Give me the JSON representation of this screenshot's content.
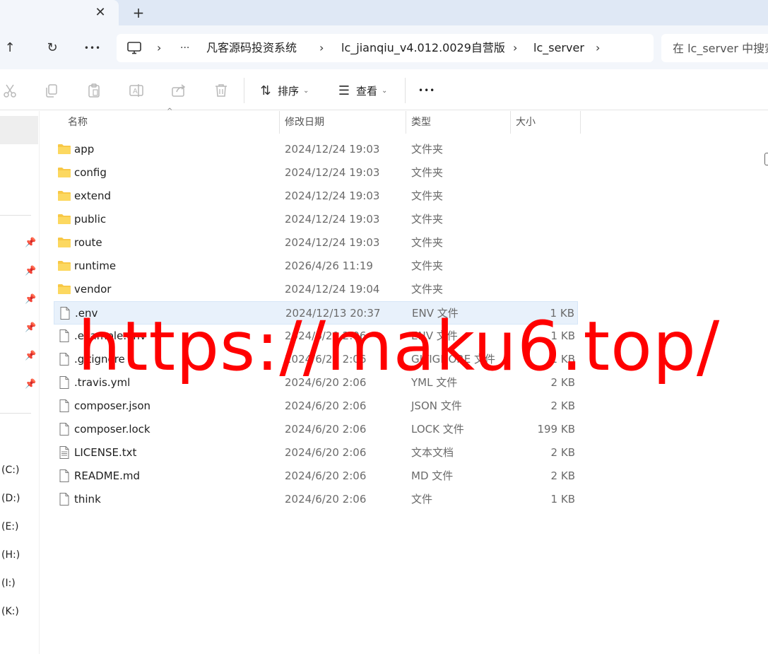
{
  "tabs": {
    "close_glyph": "✕",
    "new_glyph": "+"
  },
  "nav": {
    "up_glyph": "↑",
    "refresh_glyph": "↻",
    "more_glyph": "•••"
  },
  "breadcrumb": {
    "more_glyph": "···",
    "items": [
      {
        "label": "凡客源码投资系统"
      },
      {
        "label": "lc_jianqiu_v4.012.0029自营版"
      },
      {
        "label": "lc_server"
      }
    ],
    "chevron": "›"
  },
  "search": {
    "placeholder": "在 lc_server 中搜索"
  },
  "toolbar": {
    "sort_label": "排序",
    "view_label": "查看",
    "more_label": "•••",
    "dropdown_glyph": "⌄"
  },
  "leftnav": {
    "drives": [
      {
        "label": "(C:)"
      },
      {
        "label": "(D:)"
      },
      {
        "label": "(E:)"
      },
      {
        "label": "(H:)"
      },
      {
        "label": "(I:)"
      },
      {
        "label": "(K:)"
      }
    ]
  },
  "columns": {
    "name": "名称",
    "date": "修改日期",
    "type": "类型",
    "size": "大小",
    "sort_glyph": "^"
  },
  "files": [
    {
      "name": "app",
      "date": "2024/12/24 19:03",
      "type": "文件夹",
      "size": "",
      "icon": "folder-icon"
    },
    {
      "name": "config",
      "date": "2024/12/24 19:03",
      "type": "文件夹",
      "size": "",
      "icon": "folder-icon"
    },
    {
      "name": "extend",
      "date": "2024/12/24 19:03",
      "type": "文件夹",
      "size": "",
      "icon": "folder-icon"
    },
    {
      "name": "public",
      "date": "2024/12/24 19:03",
      "type": "文件夹",
      "size": "",
      "icon": "folder-icon"
    },
    {
      "name": "route",
      "date": "2024/12/24 19:03",
      "type": "文件夹",
      "size": "",
      "icon": "folder-icon"
    },
    {
      "name": "runtime",
      "date": "2026/4/26 11:19",
      "type": "文件夹",
      "size": "",
      "icon": "folder-icon"
    },
    {
      "name": "vendor",
      "date": "2024/12/24 19:04",
      "type": "文件夹",
      "size": "",
      "icon": "folder-icon"
    },
    {
      "name": ".env",
      "date": "2024/12/13 20:37",
      "type": "ENV 文件",
      "size": "1 KB",
      "icon": "file-icon",
      "selected": true
    },
    {
      "name": ".example.env",
      "date": "2024/6/20 2:06",
      "type": "ENV 文件",
      "size": "1 KB",
      "icon": "file-icon"
    },
    {
      "name": ".gitignore",
      "date": "2024/6/20 2:06",
      "type": "GITIGNORE 文件",
      "size": "1 KB",
      "icon": "file-icon"
    },
    {
      "name": ".travis.yml",
      "date": "2024/6/20 2:06",
      "type": "YML 文件",
      "size": "2 KB",
      "icon": "file-icon"
    },
    {
      "name": "composer.json",
      "date": "2024/6/20 2:06",
      "type": "JSON 文件",
      "size": "2 KB",
      "icon": "file-icon"
    },
    {
      "name": "composer.lock",
      "date": "2024/6/20 2:06",
      "type": "LOCK 文件",
      "size": "199 KB",
      "icon": "file-icon"
    },
    {
      "name": "LICENSE.txt",
      "date": "2024/6/20 2:06",
      "type": "文本文档",
      "size": "2 KB",
      "icon": "text-file-icon"
    },
    {
      "name": "README.md",
      "date": "2024/6/20 2:06",
      "type": "MD 文件",
      "size": "2 KB",
      "icon": "file-icon"
    },
    {
      "name": "think",
      "date": "2024/6/20 2:06",
      "type": "文件",
      "size": "1 KB",
      "icon": "file-icon"
    }
  ],
  "watermark": {
    "text": "https://maku6.top/",
    "color": "#ff0000"
  },
  "colors": {
    "tabbar": "#dfe8f5",
    "addressbar": "#f3f6fb",
    "selection": "#e8f1fb",
    "folder": "#f8c846"
  }
}
